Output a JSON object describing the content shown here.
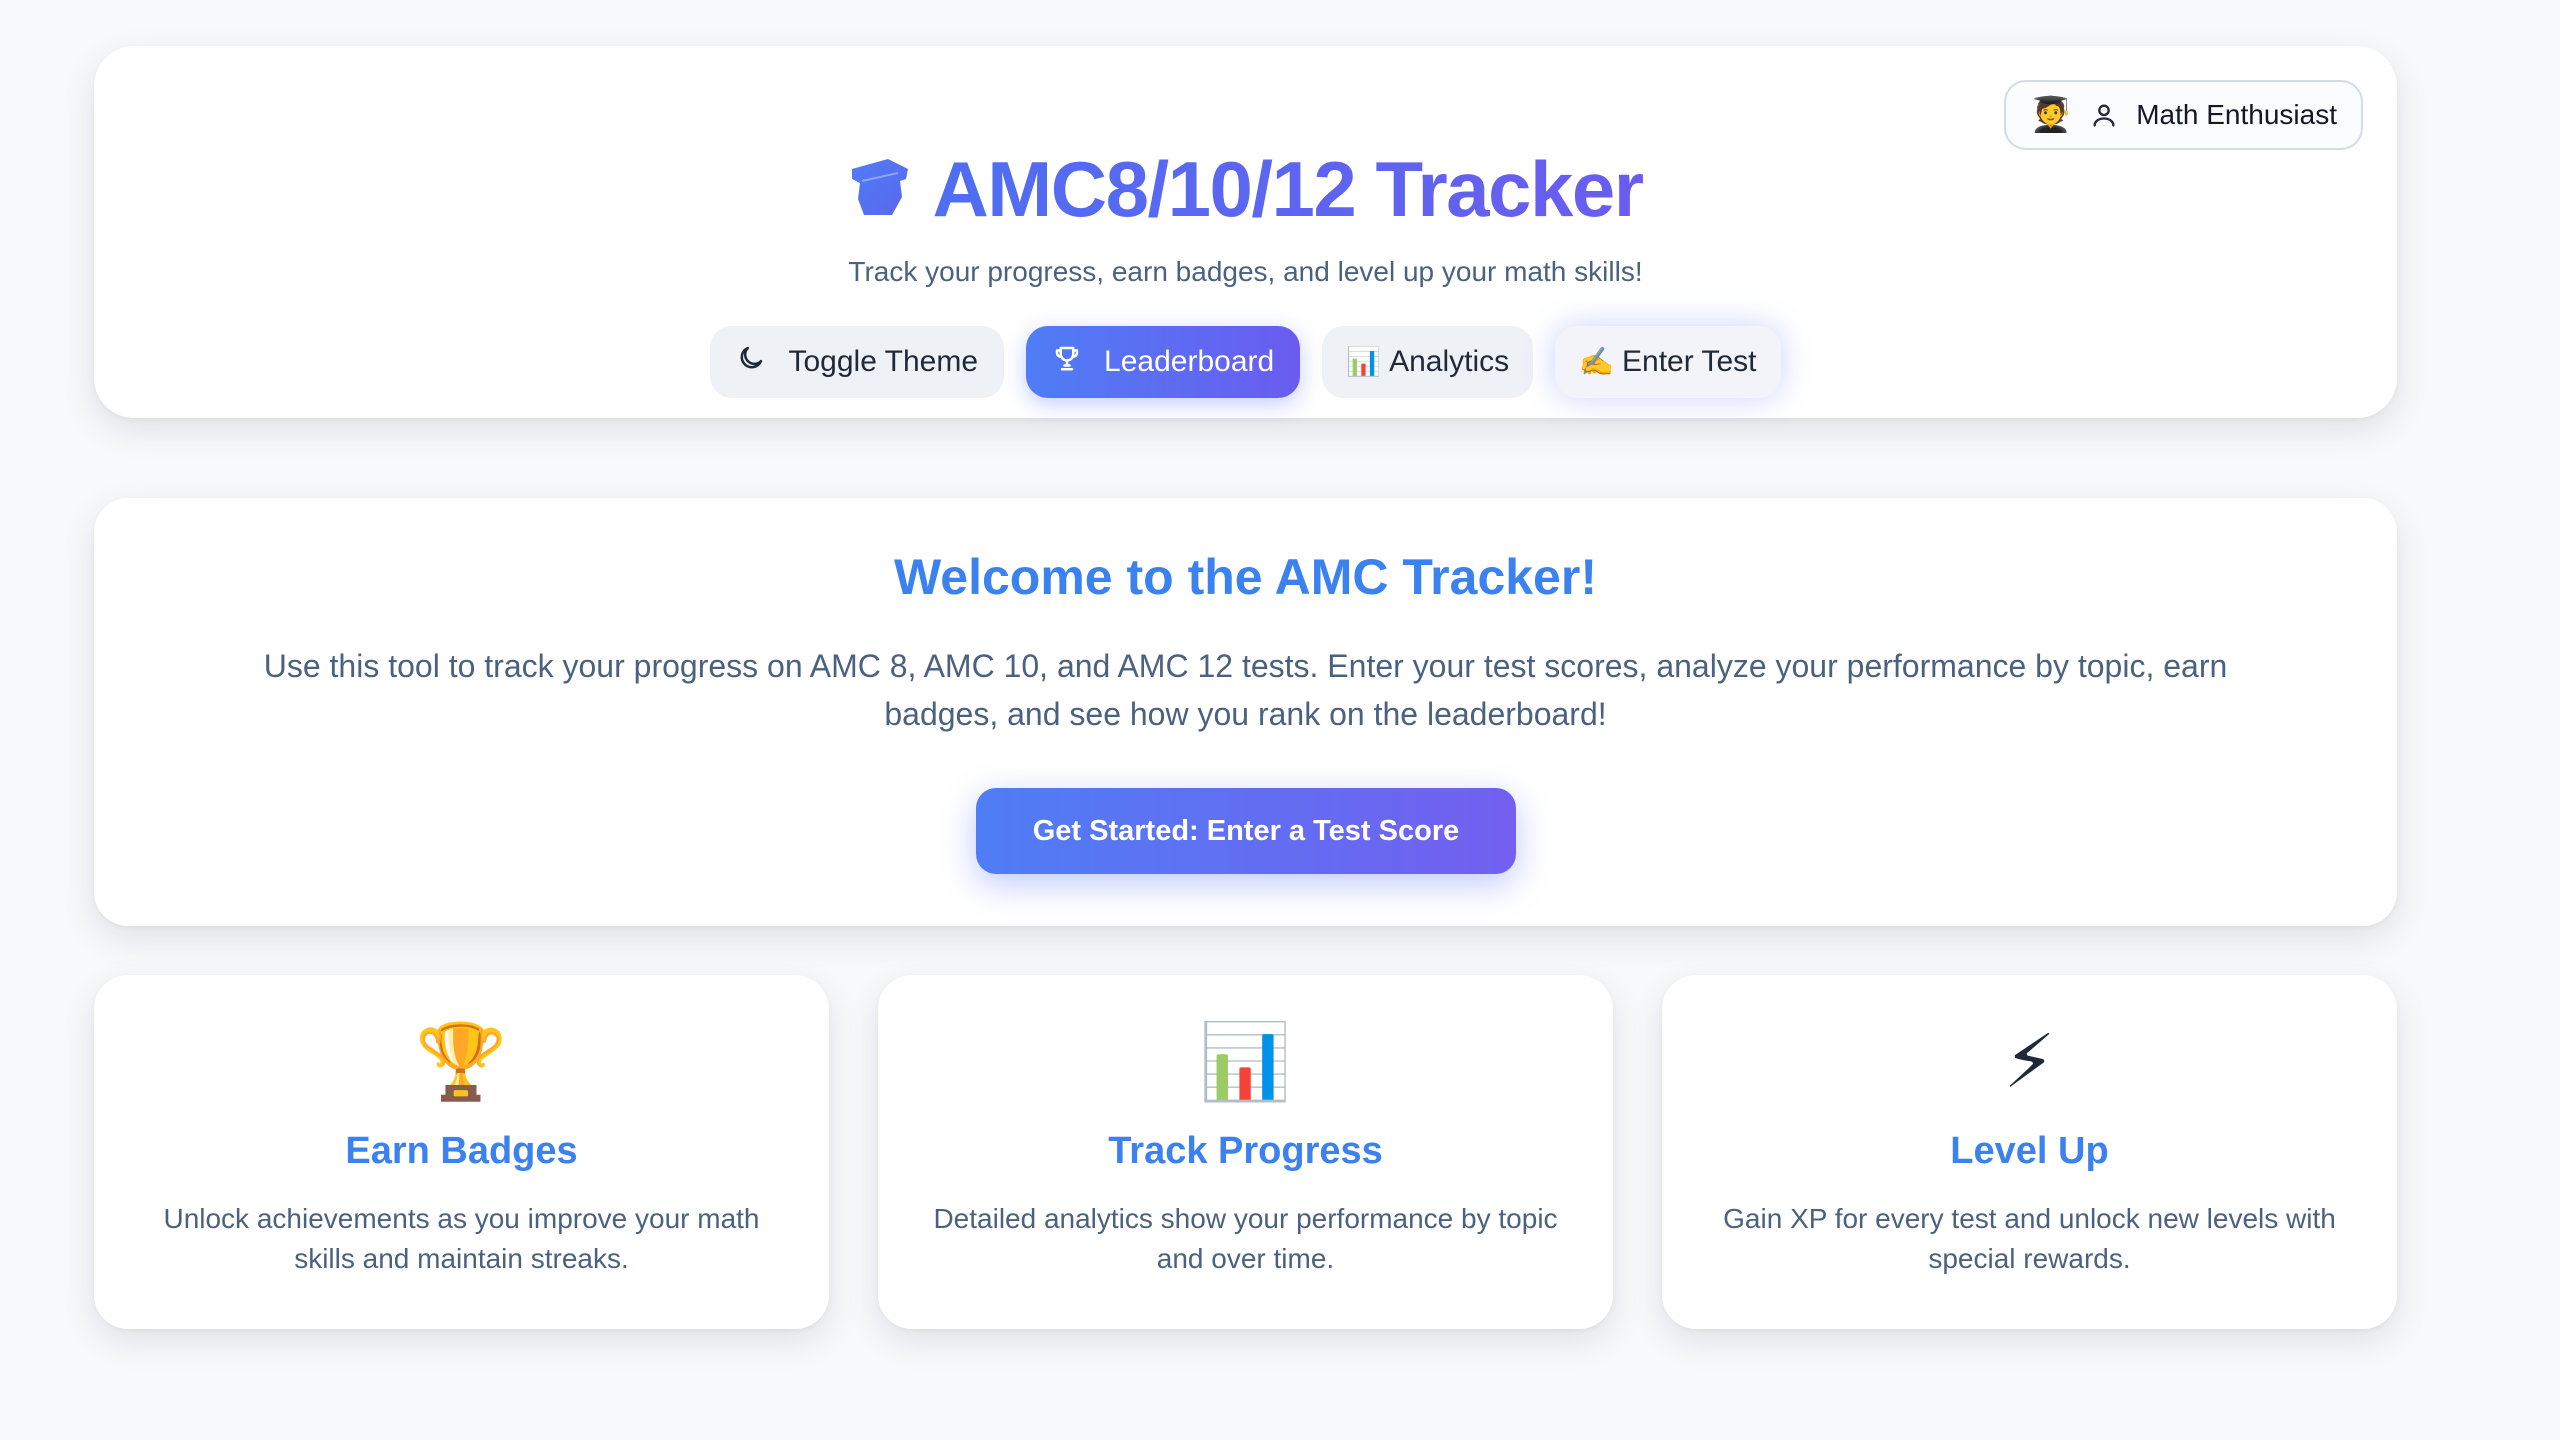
{
  "header": {
    "title": "AMC8/10/12 Tracker",
    "subtitle": "Track your progress, earn badges, and level up your math skills!",
    "icon": "graduation-cap-icon",
    "profile": {
      "emoji": "🧑‍🎓",
      "icon": "user-icon",
      "name": "Math Enthusiast"
    },
    "nav": [
      {
        "label": "Toggle Theme",
        "icon": "moon-icon"
      },
      {
        "label": "Leaderboard",
        "icon": "trophy-icon",
        "active": true
      },
      {
        "emoji": "📊",
        "label": "Analytics"
      },
      {
        "emoji": "✍️",
        "label": "Enter Test"
      }
    ]
  },
  "welcome": {
    "title": "Welcome to the AMC Tracker!",
    "text": "Use this tool to track your progress on AMC 8, AMC 10, and AMC 12 tests. Enter your test scores, analyze your performance by topic, earn badges, and see how you rank on the leaderboard!",
    "cta": "Get Started: Enter a Test Score"
  },
  "features": [
    {
      "emoji": "🏆",
      "title": "Earn Badges",
      "desc": "Unlock achievements as you improve your math skills and maintain streaks."
    },
    {
      "emoji": "📊",
      "title": "Track Progress",
      "desc": "Detailed analytics show your performance by topic and over time."
    },
    {
      "emoji": "⚡",
      "title": "Level Up",
      "desc": "Gain XP for every test and unlock new levels with special rewards."
    }
  ],
  "colors": {
    "accent": "#4f7df5",
    "accent_secondary": "#6a5cf0",
    "heading_blue": "#3b82f0",
    "muted_text": "#4a6280",
    "background": "#f8f9fb"
  }
}
